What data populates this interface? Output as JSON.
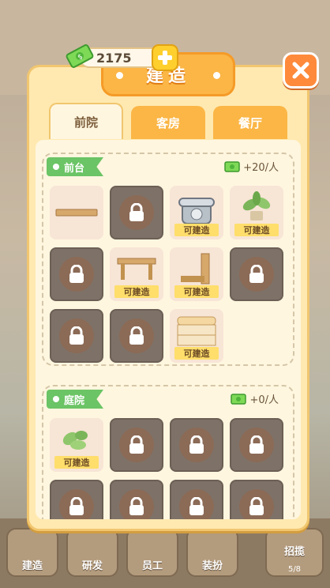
{
  "currency": {
    "amount": "2175"
  },
  "panel": {
    "title": "建造"
  },
  "tabs": [
    {
      "label": "前院",
      "active": true
    },
    {
      "label": "客房",
      "active": false
    },
    {
      "label": "餐厅",
      "active": false
    }
  ],
  "sections": [
    {
      "name": "前台",
      "income": "+20/人",
      "items": [
        {
          "state": "placed",
          "icon": "wooden-plank"
        },
        {
          "state": "locked",
          "icon": "lock"
        },
        {
          "state": "buildable",
          "icon": "telephone",
          "label": "可建造"
        },
        {
          "state": "buildable",
          "icon": "potted-plant",
          "label": "可建造"
        },
        {
          "state": "locked",
          "icon": "lock"
        },
        {
          "state": "buildable",
          "icon": "wooden-desk",
          "label": "可建造"
        },
        {
          "state": "buildable",
          "icon": "wooden-cabinet",
          "label": "可建造"
        },
        {
          "state": "locked",
          "icon": "lock"
        },
        {
          "state": "locked",
          "icon": "lock"
        },
        {
          "state": "locked",
          "icon": "lock"
        },
        {
          "state": "buildable",
          "icon": "reception-counter",
          "label": "可建造"
        }
      ]
    },
    {
      "name": "庭院",
      "income": "+0/人",
      "items": [
        {
          "state": "buildable",
          "icon": "bush-plant",
          "label": "可建造"
        },
        {
          "state": "locked",
          "icon": "lock"
        },
        {
          "state": "locked",
          "icon": "lock"
        },
        {
          "state": "locked",
          "icon": "lock"
        },
        {
          "state": "locked",
          "icon": "lock"
        },
        {
          "state": "locked",
          "icon": "lock"
        },
        {
          "state": "locked",
          "icon": "lock"
        },
        {
          "state": "locked",
          "icon": "lock"
        }
      ]
    }
  ],
  "bottom_nav": [
    {
      "label": "建造"
    },
    {
      "label": "研发"
    },
    {
      "label": "员工"
    },
    {
      "label": "装扮"
    },
    {
      "label": "招揽",
      "count": "5/8"
    }
  ]
}
